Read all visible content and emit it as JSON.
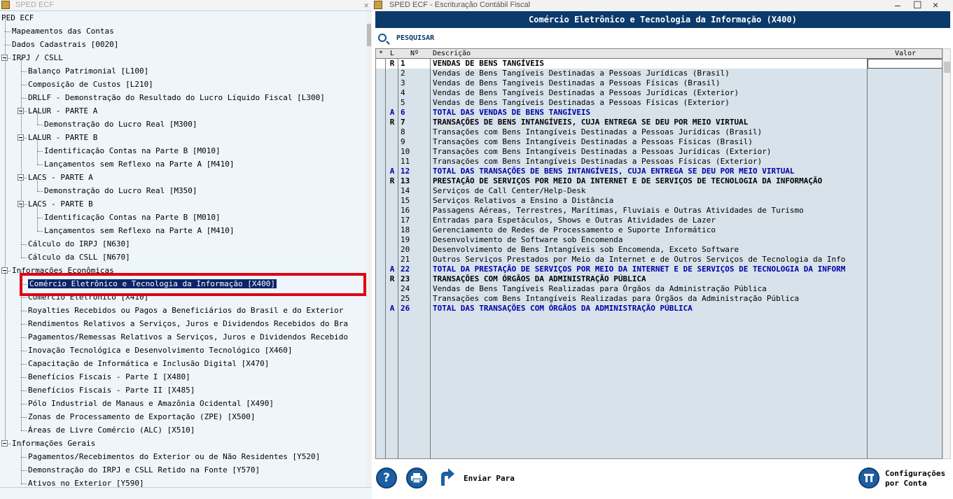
{
  "left_window": {
    "title": "SPED ECF",
    "tree": [
      {
        "label": "PED ECF",
        "level": 0
      },
      {
        "label": "Mapeamentos das Contas",
        "level": 1
      },
      {
        "label": "Dados Cadastrais [0020]",
        "level": 1
      },
      {
        "label": "IRPJ / CSLL",
        "level": 1,
        "expanded": true
      },
      {
        "label": "Balanço Patrimonial [L100]",
        "level": 2
      },
      {
        "label": "Composição de Custos [L210]",
        "level": 2
      },
      {
        "label": "DRLLF - Demonstração do Resultado do Lucro Líquido Fiscal [L300]",
        "level": 2
      },
      {
        "label": "LALUR - PARTE A",
        "level": 2,
        "expanded": true
      },
      {
        "label": "Demonstração do Lucro Real [M300]",
        "level": 3
      },
      {
        "label": "LALUR - PARTE B",
        "level": 2,
        "expanded": true
      },
      {
        "label": "Identificação Contas na Parte B [M010]",
        "level": 3
      },
      {
        "label": "Lançamentos sem Reflexo na Parte A [M410]",
        "level": 3
      },
      {
        "label": "LACS - PARTE A",
        "level": 2,
        "expanded": true
      },
      {
        "label": "Demonstração do Lucro Real [M350]",
        "level": 3
      },
      {
        "label": "LACS - PARTE B",
        "level": 2,
        "expanded": true
      },
      {
        "label": "Identificação Contas na Parte B [M010]",
        "level": 3
      },
      {
        "label": "Lançamentos sem Reflexo na Parte A [M410]",
        "level": 3
      },
      {
        "label": "Cálculo do IRPJ [N630]",
        "level": 2
      },
      {
        "label": "Cálculo da CSLL [N670]",
        "level": 2
      },
      {
        "label": "Informações Econômicas",
        "level": 1,
        "expanded": true
      },
      {
        "label": "Comércio Eletrônico e Tecnologia da Informação [X400]",
        "level": 2,
        "selected": true
      },
      {
        "label": "Comércio Eletrônico [X410]",
        "level": 2
      },
      {
        "label": "Royalties Recebidos ou Pagos a Beneficiários do Brasil e do Exterior",
        "level": 2
      },
      {
        "label": "Rendimentos Relativos a Serviços, Juros e Dividendos Recebidos do Bra",
        "level": 2
      },
      {
        "label": "Pagamentos/Remessas Relativos a Serviços, Juros e Dividendos Recebido",
        "level": 2
      },
      {
        "label": "Inovação Tecnológica e Desenvolvimento Tecnológico [X460]",
        "level": 2
      },
      {
        "label": "Capacitação de Informática e Inclusão Digital [X470]",
        "level": 2
      },
      {
        "label": "Benefícios Fiscais - Parte I [X480]",
        "level": 2
      },
      {
        "label": "Benefícios Fiscais - Parte II [X485]",
        "level": 2
      },
      {
        "label": "Pólo Industrial de Manaus e Amazônia Ocidental [X490]",
        "level": 2
      },
      {
        "label": "Zonas de Processamento de Exportação (ZPE) [X500]",
        "level": 2
      },
      {
        "label": "Áreas de Livre Comércio (ALC) [X510]",
        "level": 2
      },
      {
        "label": "Informações Gerais",
        "level": 1,
        "expanded": true
      },
      {
        "label": "Pagamentos/Recebimentos do Exterior ou de Não Residentes [Y520]",
        "level": 2
      },
      {
        "label": "Demonstração do IRPJ e CSLL Retido na Fonte [Y570]",
        "level": 2
      },
      {
        "label": "Ativos no Exterior [Y590]",
        "level": 2
      }
    ]
  },
  "right_window": {
    "title": "SPED ECF - Escrituração Contábil Fiscal",
    "header": "Comércio Eletrônico e Tecnologia da Informação (X400)",
    "search_label": "PESQUISAR",
    "columns": {
      "star": "*",
      "l": "L",
      "n": "Nº",
      "desc": "Descrição",
      "valor": "Valor"
    },
    "rows": [
      {
        "l": "R",
        "n": "1",
        "desc": "VENDAS DE BENS TANGÍVEIS",
        "style": "bold"
      },
      {
        "l": "",
        "n": "2",
        "desc": "Vendas de Bens Tangíveis Destinadas a Pessoas Jurídicas (Brasil)",
        "style": "normal"
      },
      {
        "l": "",
        "n": "3",
        "desc": "Vendas de Bens Tangíveis Destinadas a Pessoas Físicas (Brasil)",
        "style": "normal"
      },
      {
        "l": "",
        "n": "4",
        "desc": "Vendas de Bens Tangíveis Destinadas a Pessoas Jurídicas (Exterior)",
        "style": "normal"
      },
      {
        "l": "",
        "n": "5",
        "desc": "Vendas de Bens Tangíveis Destinadas a Pessoas Físicas (Exterior)",
        "style": "normal"
      },
      {
        "l": "A",
        "n": "6",
        "desc": "TOTAL DAS VENDAS DE BENS TANGÍVEIS",
        "style": "blue"
      },
      {
        "l": "R",
        "n": "7",
        "desc": "TRANSAÇÕES DE BENS INTANGÍVEIS, CUJA ENTREGA SE DEU POR MEIO VIRTUAL",
        "style": "bold"
      },
      {
        "l": "",
        "n": "8",
        "desc": "Transações com Bens Intangíveis Destinadas a Pessoas Jurídicas (Brasil)",
        "style": "normal"
      },
      {
        "l": "",
        "n": "9",
        "desc": "Transações com Bens Intangíveis Destinadas a Pessoas Físicas (Brasil)",
        "style": "normal"
      },
      {
        "l": "",
        "n": "10",
        "desc": "Transações com Bens Intangíveis Destinadas a Pessoas Jurídicas (Exterior)",
        "style": "normal"
      },
      {
        "l": "",
        "n": "11",
        "desc": "Transações com Bens Intangíveis Destinadas a Pessoas Físicas (Exterior)",
        "style": "normal"
      },
      {
        "l": "A",
        "n": "12",
        "desc": "TOTAL DAS TRANSAÇÕES DE BENS INTANGÍVEIS, CUJA ENTREGA SE DEU POR MEIO VIRTUAL",
        "style": "blue"
      },
      {
        "l": "R",
        "n": "13",
        "desc": "PRESTAÇÃO DE SERVIÇOS POR MEIO DA INTERNET E DE SERVIÇOS DE TECNOLOGIA DA INFORMAÇÃO",
        "style": "bold"
      },
      {
        "l": "",
        "n": "14",
        "desc": "Serviços de Call Center/Help-Desk",
        "style": "normal"
      },
      {
        "l": "",
        "n": "15",
        "desc": "Serviços Relativos a Ensino a Distância",
        "style": "normal"
      },
      {
        "l": "",
        "n": "16",
        "desc": "Passagens Aéreas, Terrestres, Marítimas, Fluviais e Outras Atividades de Turismo",
        "style": "normal"
      },
      {
        "l": "",
        "n": "17",
        "desc": "Entradas para Espetáculos, Shows e Outras Atividades de Lazer",
        "style": "normal"
      },
      {
        "l": "",
        "n": "18",
        "desc": "Gerenciamento de Redes de Processamento e Suporte Informático",
        "style": "normal"
      },
      {
        "l": "",
        "n": "19",
        "desc": "Desenvolvimento de Software sob Encomenda",
        "style": "normal"
      },
      {
        "l": "",
        "n": "20",
        "desc": "Desenvolvimento de Bens Intangíveis sob Encomenda, Exceto Software",
        "style": "normal"
      },
      {
        "l": "",
        "n": "21",
        "desc": "Outros Serviços Prestados por Meio da Internet e de Outros Serviços de Tecnologia da Info",
        "style": "normal"
      },
      {
        "l": "A",
        "n": "22",
        "desc": "TOTAL DA PRESTAÇÃO DE SERVIÇOS POR MEIO DA INTERNET E DE SERVIÇOS DE TECNOLOGIA DA INFORM",
        "style": "blue"
      },
      {
        "l": "R",
        "n": "23",
        "desc": "TRANSAÇÕES COM ÓRGÃOS DA ADMINISTRAÇÃO PÚBLICA",
        "style": "bold"
      },
      {
        "l": "",
        "n": "24",
        "desc": "Vendas de Bens Tangíveis Realizadas para Órgãos da Administração Pública",
        "style": "normal"
      },
      {
        "l": "",
        "n": "25",
        "desc": "Transações com Bens Intangíveis Realizadas para Órgãos da Administração Pública",
        "style": "normal"
      },
      {
        "l": "A",
        "n": "26",
        "desc": "TOTAL DAS TRANSAÇÕES COM ÓRGÃOS DA ADMINISTRAÇÃO PÚBLICA",
        "style": "blue"
      }
    ],
    "toolbar": {
      "help_glyph": "?",
      "send_label": "Enviar Para",
      "config_label_1": "Configurações",
      "config_label_2": "por Conta"
    }
  }
}
